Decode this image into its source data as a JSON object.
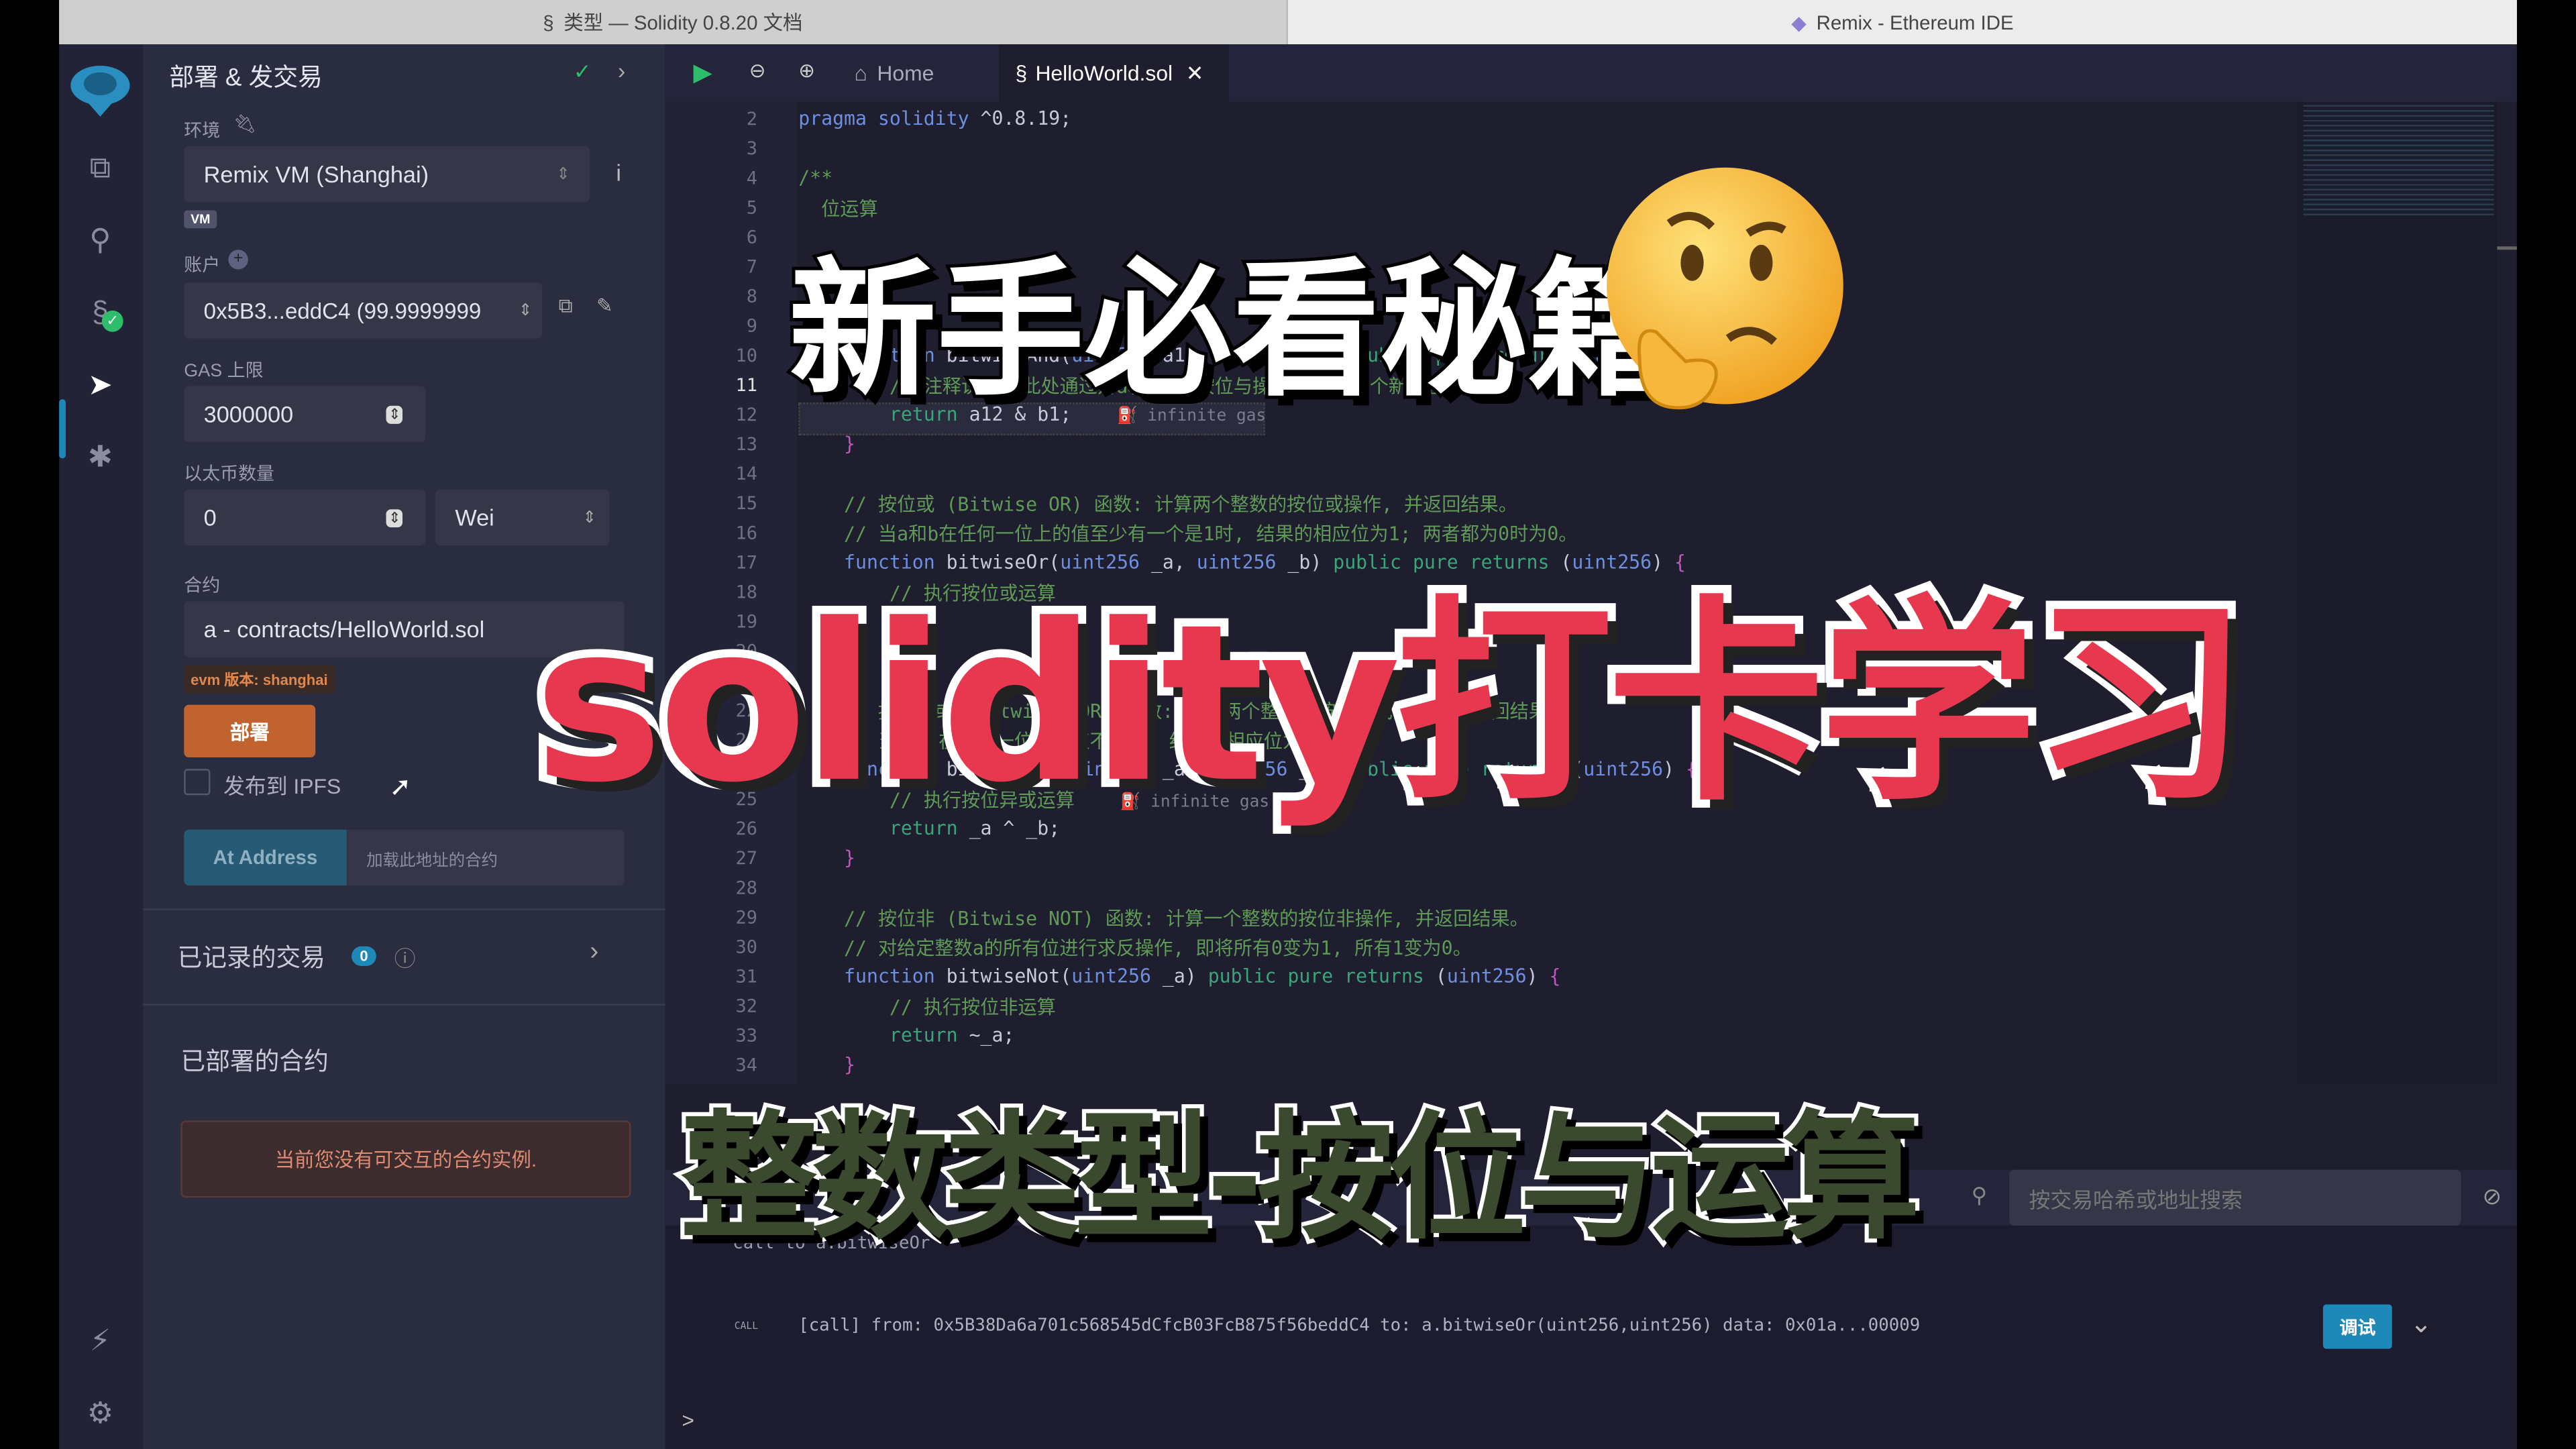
{
  "browser": {
    "tabs": [
      {
        "label": "类型 — Solidity 0.8.20 文档",
        "icon": "solidity-icon"
      },
      {
        "label": "Remix - Ethereum IDE",
        "icon": "ethereum-icon"
      }
    ]
  },
  "icon_bar": {
    "items": [
      "remix-logo-icon",
      "file-explorer-icon",
      "search-icon",
      "solidity-compiler-icon",
      "deploy-run-icon",
      "debugger-icon"
    ],
    "bottom": [
      "plugin-manager-icon",
      "settings-icon"
    ]
  },
  "panel": {
    "title": "部署 & 发交易",
    "env_label": "环境",
    "env_value": "Remix VM (Shanghai)",
    "vm_badge": "VM",
    "account_label": "账户",
    "account_value": "0x5B3...eddC4 (99.9999999",
    "gas_label": "GAS 上限",
    "gas_value": "3000000",
    "value_label": "以太币数量",
    "value_value": "0",
    "unit_value": "Wei",
    "contract_label": "合约",
    "contract_value": "a - contracts/HelloWorld.sol",
    "evm_badge": "evm 版本: shanghai",
    "deploy_button": "部署",
    "ipfs_label": "发布到 IPFS",
    "ipfs_checked": false,
    "at_address_button": "At Address",
    "at_address_placeholder": "加载此地址的合约",
    "recorded_tx_label": "已记录的交易",
    "recorded_tx_count": "0",
    "deployed_label": "已部署的合约",
    "no_instance_msg": "当前您没有可交互的合约实例."
  },
  "editor": {
    "tabs": [
      {
        "label": "Home"
      },
      {
        "label": "HelloWorld.sol",
        "active": true
      }
    ],
    "lines": [
      {
        "n": "2",
        "html": "<span class='kw'>pragma solidity</span> ^0.8.19;"
      },
      {
        "n": "3",
        "html": ""
      },
      {
        "n": "4",
        "html": "<span class='cm'>/**</span>"
      },
      {
        "n": "5",
        "html": "<span class='cm'>  位运算</span>"
      },
      {
        "n": "6",
        "html": ""
      },
      {
        "n": "7",
        "html": ""
      },
      {
        "n": "8",
        "html": ""
      },
      {
        "n": "9",
        "html": "<span class='cm'>                                                     0。</span>"
      },
      {
        "n": "10",
        "html": "    <span class='kw'>function</span> bitwiseAnd(<span class='kw'>uint256</span> a12, <span class='kw'>uint256</span> b1) <span class='gr'>public pure returns</span> (<span class='kw'>uint256</span>) <span class='pu'>{</span>"
      },
      {
        "n": "11",
        "html": "        <span class='cm'>// 注释说明: 此处通过对a和b进行按位与操作, 得到一个新的整数,</span>"
      },
      {
        "n": "12",
        "html": "        <span class='gr'>return</span> a12 &amp; b1;    <span class='gas'>⛽ infinite gas</span>"
      },
      {
        "n": "13",
        "html": "    <span class='pu'>}</span>"
      },
      {
        "n": "14",
        "html": ""
      },
      {
        "n": "15",
        "html": "    <span class='cm'>// 按位或 (Bitwise OR) 函数: 计算两个整数的按位或操作, 并返回结果。</span>"
      },
      {
        "n": "16",
        "html": "    <span class='cm'>// 当a和b在任何一位上的值至少有一个是1时, 结果的相应位为1; 两者都为0时为0。</span>"
      },
      {
        "n": "17",
        "html": "    <span class='kw'>function</span> bitwiseOr(<span class='kw'>uint256</span> _a, <span class='kw'>uint256</span> _b) <span class='gr'>public pure returns</span> (<span class='kw'>uint256</span>) <span class='pu'>{</span>"
      },
      {
        "n": "18",
        "html": "        <span class='cm'>// 执行按位或运算</span>"
      },
      {
        "n": "19",
        "html": ""
      },
      {
        "n": "20",
        "html": ""
      },
      {
        "n": "21",
        "html": ""
      },
      {
        "n": "22",
        "html": "    <span class='cm'>// 按位异或 (Bitwise XOR) 函数: 计算两个整数的按位异或操作, 并返回结果。</span>"
      },
      {
        "n": "23",
        "html": "    <span class='cm'>// 当a和b在任何一位上的值不同时, 结果的相应位为1。</span>"
      },
      {
        "n": "24",
        "html": "    <span class='kw'>function</span> bitwiseXOr(<span class='kw'>uint256</span> _a, <span class='kw'>uint256</span> _b) <span class='gr'>public pure returns</span> (<span class='kw'>uint256</span>) <span class='pu'>{</span>"
      },
      {
        "n": "25",
        "html": "        <span class='cm'>// 执行按位异或运算</span>    <span class='gas'>⛽ infinite gas</span>"
      },
      {
        "n": "26",
        "html": "        <span class='gr'>return</span> _a ^ _b;"
      },
      {
        "n": "27",
        "html": "    <span class='pu'>}</span>"
      },
      {
        "n": "28",
        "html": ""
      },
      {
        "n": "29",
        "html": "    <span class='cm'>// 按位非 (Bitwise NOT) 函数: 计算一个整数的按位非操作, 并返回结果。</span>"
      },
      {
        "n": "30",
        "html": "    <span class='cm'>// 对给定整数a的所有位进行求反操作, 即将所有0变为1, 所有1变为0。</span>"
      },
      {
        "n": "31",
        "html": "    <span class='kw'>function</span> bitwiseNot(<span class='kw'>uint256</span> _a) <span class='gr'>public pure returns</span> (<span class='kw'>uint256</span>) <span class='pu'>{</span>"
      },
      {
        "n": "32",
        "html": "        <span class='cm'>// 执行按位非运算</span>"
      },
      {
        "n": "33",
        "html": "        <span class='gr'>return</span> ~_a;"
      },
      {
        "n": "34",
        "html": "    <span class='pu'>}</span>"
      }
    ]
  },
  "terminal": {
    "search_placeholder": "按交易哈希或地址搜索",
    "line1": "call to a.bitwiseOr",
    "call_tag": "CALL",
    "call_line": "[call]  from: 0x5B38Da6a701c568545dCfcB03FcB875f56beddC4 to: a.bitwiseOr(uint256,uint256) data: 0x01a...00009",
    "debug_button": "调试",
    "prompt": ">"
  },
  "overlay": {
    "title_top": "新手必看秘籍",
    "title_main": "solidity打卡学习",
    "title_bottom": "整数类型-按位与运算",
    "emoji": "thinking-face",
    "colors": {
      "main": "#e8384f",
      "bottom": "#3b4a2f",
      "top": "#ffffff"
    }
  },
  "colors": {
    "accent": "#1e88b6",
    "deploy": "#c0632f",
    "success": "#2ebd6b"
  }
}
